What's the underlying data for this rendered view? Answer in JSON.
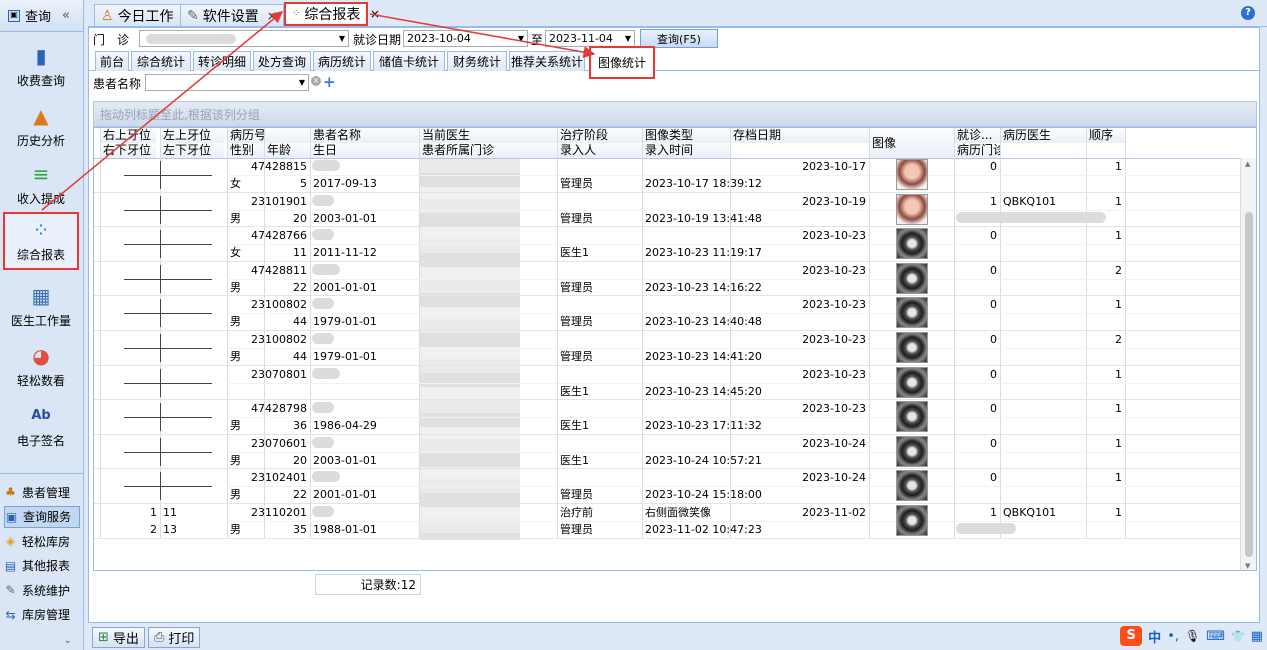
{
  "nav": {
    "header": "查询",
    "collapse": "«",
    "items": [
      {
        "label": "收费查询",
        "icon": "bar-chart-icon",
        "color": "#2a63b8"
      },
      {
        "label": "历史分析",
        "icon": "trend-chart-icon",
        "color": "#e07820"
      },
      {
        "label": "收入提成",
        "icon": "stack-icon",
        "color": "#3aa04a"
      },
      {
        "label": "综合报表",
        "icon": "scatter-icon",
        "color": "#2f7fd6"
      },
      {
        "label": "医生工作量",
        "icon": "calendar-icon",
        "color": "#3b6fb5"
      },
      {
        "label": "轻松数看",
        "icon": "pie-chart-icon",
        "color": "#e0503a"
      },
      {
        "label": "电子签名",
        "icon": "signature-icon",
        "glyph": "Ab",
        "color": "#2a4e9c"
      }
    ],
    "small": [
      "患者管理",
      "查询服务",
      "轻松库房",
      "其他报表",
      "系统维护",
      "库房管理"
    ],
    "more": "⌄"
  },
  "toptabs": [
    {
      "label": "今日工作",
      "icon": "home-icon"
    },
    {
      "label": "软件设置",
      "icon": "wrench-icon",
      "close": "×"
    },
    {
      "label": "综合报表",
      "icon": "report-icon",
      "close": "×"
    }
  ],
  "filter": {
    "clinic_label": "门　诊",
    "date_label": "就诊日期",
    "date_from": "2023-10-04",
    "to_label": "至",
    "date_to": "2023-11-04",
    "query_btn": "查询(F5)"
  },
  "subtabs": [
    "前台",
    "综合统计",
    "转诊明细",
    "处方查询",
    "病历统计",
    "储值卡统计",
    "财务统计",
    "推荐关系统计",
    "图像统计"
  ],
  "search": {
    "label": "患者名称"
  },
  "group_hint": "拖动列标题至此,根据该列分组",
  "columns": {
    "top": [
      "右上牙位",
      "左上牙位",
      "病历号",
      "患者名称",
      "当前医生",
      "治疗阶段",
      "图像类型",
      "存档日期",
      "图像",
      "就诊...",
      "病历医生",
      "顺序"
    ],
    "bottom": [
      "右下牙位",
      "左下牙位",
      "性别",
      "年龄",
      "生日",
      "患者所属门诊",
      "录入人",
      "录入时间",
      "病历门诊"
    ]
  },
  "rows": [
    {
      "no": "47428815",
      "sex": "女",
      "age": "5",
      "birth": "2017-09-13",
      "stage": "",
      "recorder": "管理员",
      "type": "",
      "time": "2023-10-17 18:39:12",
      "date": "2023-10-17",
      "visit": "0",
      "doctor": "",
      "order": "1",
      "img": "face"
    },
    {
      "no": "23101901",
      "sex": "男",
      "age": "20",
      "birth": "2003-01-01",
      "stage": "",
      "recorder": "管理员",
      "type": "",
      "time": "2023-10-19 13:41:48",
      "date": "2023-10-19",
      "visit": "1",
      "doctor": "QBKQ101",
      "order": "1",
      "img": "face"
    },
    {
      "no": "47428766",
      "sex": "女",
      "age": "11",
      "birth": "2011-11-12",
      "stage": "",
      "recorder": "医生1",
      "type": "",
      "time": "2023-10-23 11:19:17",
      "date": "2023-10-23",
      "visit": "0",
      "doctor": "",
      "order": "1",
      "img": "xray"
    },
    {
      "no": "47428811",
      "sex": "男",
      "age": "22",
      "birth": "2001-01-01",
      "stage": "",
      "recorder": "管理员",
      "type": "",
      "time": "2023-10-23 14:16:22",
      "date": "2023-10-23",
      "visit": "0",
      "doctor": "",
      "order": "2",
      "img": "xray"
    },
    {
      "no": "23100802",
      "sex": "男",
      "age": "44",
      "birth": "1979-01-01",
      "stage": "",
      "recorder": "管理员",
      "type": "",
      "time": "2023-10-23 14:40:48",
      "date": "2023-10-23",
      "visit": "0",
      "doctor": "",
      "order": "1",
      "img": "xray"
    },
    {
      "no": "23100802",
      "sex": "男",
      "age": "44",
      "birth": "1979-01-01",
      "stage": "",
      "recorder": "管理员",
      "type": "",
      "time": "2023-10-23 14:41:20",
      "date": "2023-10-23",
      "visit": "0",
      "doctor": "",
      "order": "2",
      "img": "xray"
    },
    {
      "no": "23070801",
      "sex": "",
      "age": "",
      "birth": "",
      "stage": "",
      "recorder": "医生1",
      "type": "",
      "time": "2023-10-23 14:45:20",
      "date": "2023-10-23",
      "visit": "0",
      "doctor": "",
      "order": "1",
      "img": "xray"
    },
    {
      "no": "47428798",
      "sex": "男",
      "age": "36",
      "birth": "1986-04-29",
      "stage": "",
      "recorder": "医生1",
      "type": "",
      "time": "2023-10-23 17:11:32",
      "date": "2023-10-23",
      "visit": "0",
      "doctor": "",
      "order": "1",
      "img": "xray"
    },
    {
      "no": "23070601",
      "sex": "男",
      "age": "20",
      "birth": "2003-01-01",
      "stage": "",
      "recorder": "医生1",
      "type": "",
      "time": "2023-10-24 10:57:21",
      "date": "2023-10-24",
      "visit": "0",
      "doctor": "",
      "order": "1",
      "img": "xray"
    },
    {
      "no": "23102401",
      "sex": "男",
      "age": "22",
      "birth": "2001-01-01",
      "stage": "",
      "recorder": "管理员",
      "type": "",
      "time": "2023-10-24 15:18:00",
      "date": "2023-10-24",
      "visit": "0",
      "doctor": "",
      "order": "1",
      "img": "xray"
    },
    {
      "no": "23110201",
      "sex": "男",
      "age": "35",
      "birth": "1988-01-01",
      "stage": "治疗前",
      "recorder": "管理员",
      "type": "右侧面微笑像",
      "time": "2023-11-02 10:47:23",
      "date": "2023-11-02",
      "visit": "1",
      "doctor": "QBKQ101",
      "order": "1",
      "img": "xray",
      "ur": "1",
      "ul": "11",
      "lr": "2",
      "ll": "13"
    }
  ],
  "record_count": "记录数:12",
  "bottom": {
    "export": "导出",
    "print": "打印"
  },
  "ime": {
    "logo": "S",
    "lang": "中",
    "dot": "•,",
    "mic": "🎙",
    "kb": "⌨",
    "shirt": "👕",
    "grid": "▦"
  },
  "help": "?"
}
